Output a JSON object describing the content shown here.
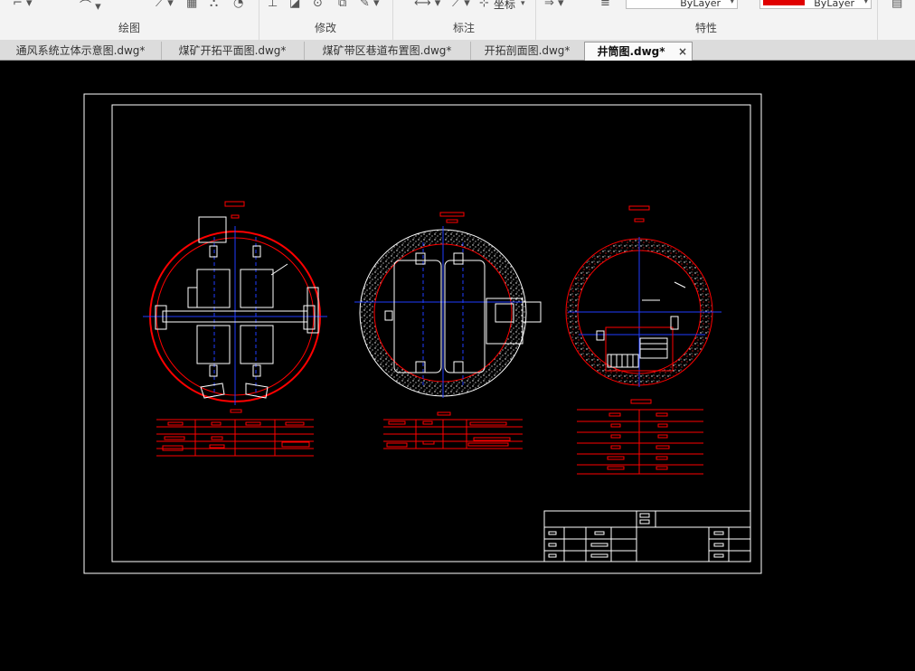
{
  "ribbon": {
    "groups": [
      {
        "label": "绘图"
      },
      {
        "label": "修改"
      },
      {
        "label": "标注"
      },
      {
        "label": "特性"
      }
    ],
    "annotate_label": "坐标",
    "layer_combo": "ByLayer",
    "color_combo": "ByLayer"
  },
  "tabs": [
    {
      "label": "通风系统立体示意图.dwg*"
    },
    {
      "label": "煤矿开拓平面图.dwg*"
    },
    {
      "label": "煤矿带区巷道布置图.dwg*"
    },
    {
      "label": "开拓剖面图.dwg*"
    },
    {
      "label": "井筒图.dwg*"
    }
  ],
  "colors": {
    "ribbon_bg": "#f3f3f3",
    "canvas_bg": "#000000",
    "drawing_red": "#ff0000",
    "drawing_blue": "#1f3cff",
    "drawing_white": "#ffffff"
  }
}
